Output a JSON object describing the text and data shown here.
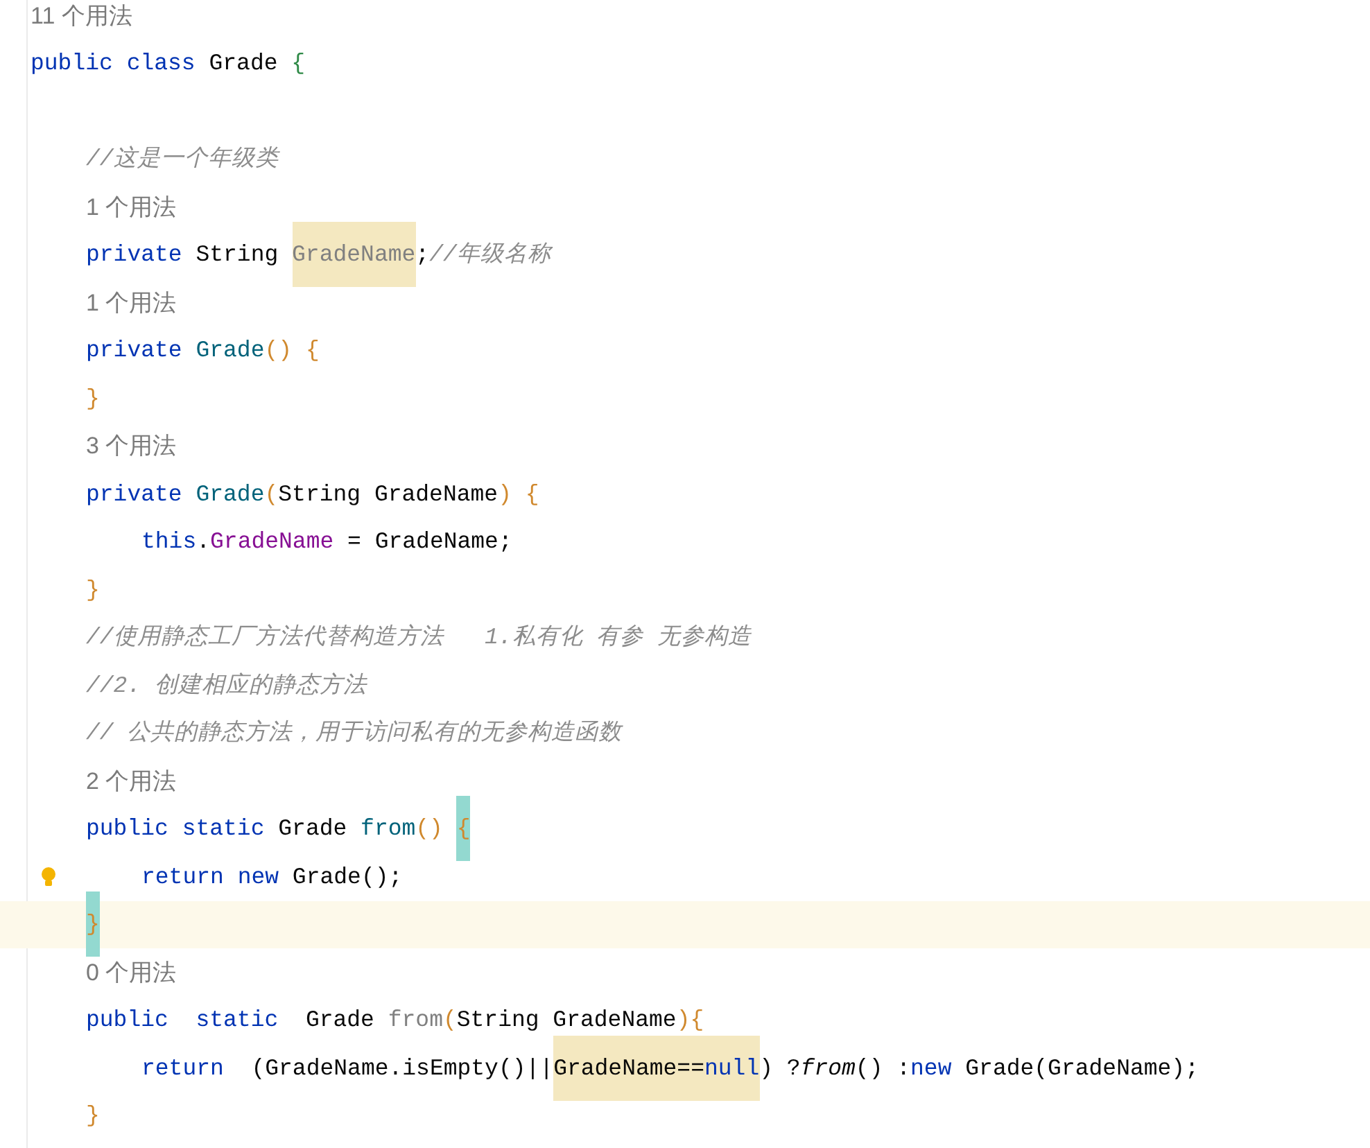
{
  "editor": {
    "lines": [
      {
        "kind": "hint",
        "text": "11 个用法"
      },
      {
        "kind": "code",
        "tokens": [
          {
            "kind": "kw",
            "text": "public"
          },
          {
            "kind": "kw",
            "text": " class"
          },
          {
            "kind": "plain",
            "text": " Grade "
          },
          {
            "kind": "brace2",
            "text": "{"
          }
        ],
        "children": [
          {
            "kind": "blank"
          },
          {
            "kind": "code",
            "tokens": [
              {
                "kind": "comment",
                "text": "//这是一个年级类"
              }
            ]
          },
          {
            "kind": "hint",
            "text": "1 个用法"
          },
          {
            "kind": "code",
            "tokens": [
              {
                "kind": "kw",
                "text": "private"
              },
              {
                "kind": "plain",
                "text": " String "
              },
              {
                "kind": "unused",
                "text": "GradeName",
                "usage_highlight": true
              },
              {
                "kind": "plain",
                "text": ";"
              },
              {
                "kind": "comment",
                "text": "//年级名称"
              }
            ]
          },
          {
            "kind": "hint",
            "text": "1 个用法"
          },
          {
            "kind": "code",
            "tokens": [
              {
                "kind": "kw",
                "text": "private"
              },
              {
                "kind": "decl",
                "text": " Grade"
              },
              {
                "kind": "brace",
                "text": "() {"
              }
            ]
          },
          {
            "kind": "code",
            "tokens": [
              {
                "kind": "brace",
                "text": "}"
              }
            ]
          },
          {
            "kind": "hint",
            "text": "3 个用法"
          },
          {
            "kind": "code",
            "tokens": [
              {
                "kind": "kw",
                "text": "private"
              },
              {
                "kind": "decl",
                "text": " Grade"
              },
              {
                "kind": "brace",
                "text": "("
              },
              {
                "kind": "plain",
                "text": "String GradeName"
              },
              {
                "kind": "brace",
                "text": ") {"
              }
            ],
            "children": [
              {
                "kind": "code",
                "tokens": [
                  {
                    "kind": "kw",
                    "text": "this"
                  },
                  {
                    "kind": "plain",
                    "text": "."
                  },
                  {
                    "kind": "field",
                    "text": "GradeName"
                  },
                  {
                    "kind": "plain",
                    "text": " = GradeName;"
                  }
                ]
              }
            ]
          },
          {
            "kind": "code",
            "tokens": [
              {
                "kind": "brace",
                "text": "}"
              }
            ]
          },
          {
            "kind": "code",
            "tokens": [
              {
                "kind": "comment",
                "text": "//使用静态工厂方法代替构造方法   1.私有化 有参 无参构造"
              }
            ]
          },
          {
            "kind": "code",
            "tokens": [
              {
                "kind": "comment",
                "text": "//2. 创建相应的静态方法"
              }
            ]
          },
          {
            "kind": "code",
            "tokens": [
              {
                "kind": "comment",
                "text": "// 公共的静态方法，用于访问私有的无参构造函数"
              }
            ]
          },
          {
            "kind": "hint",
            "text": "2 个用法"
          },
          {
            "kind": "code",
            "tokens": [
              {
                "kind": "kw",
                "text": "public"
              },
              {
                "kind": "kw",
                "text": " static"
              },
              {
                "kind": "plain",
                "text": " Grade "
              },
              {
                "kind": "decl",
                "text": "from"
              },
              {
                "kind": "brace",
                "text": "() "
              },
              {
                "kind": "brace",
                "text": "{",
                "brace_match": true
              }
            ],
            "children": [
              {
                "kind": "code",
                "bulb": true,
                "tokens": [
                  {
                    "kind": "kw",
                    "text": "return"
                  },
                  {
                    "kind": "kw",
                    "text": " new"
                  },
                  {
                    "kind": "plain",
                    "text": " Grade();"
                  }
                ]
              }
            ]
          },
          {
            "kind": "code",
            "current": true,
            "tokens": [
              {
                "kind": "brace",
                "text": "}",
                "brace_match": true
              }
            ]
          },
          {
            "kind": "hint",
            "text": "0 个用法"
          },
          {
            "kind": "code",
            "tokens": [
              {
                "kind": "kw",
                "text": "public"
              },
              {
                "kind": "kw",
                "text": "  static"
              },
              {
                "kind": "plain",
                "text": "  Grade "
              },
              {
                "kind": "unused",
                "text": "from"
              },
              {
                "kind": "brace",
                "text": "("
              },
              {
                "kind": "plain",
                "text": "String GradeName"
              },
              {
                "kind": "brace",
                "text": "){"
              }
            ],
            "children": [
              {
                "kind": "code",
                "tokens": [
                  {
                    "kind": "kw",
                    "text": "return"
                  },
                  {
                    "kind": "plain",
                    "text": "  (GradeName.isEmpty()||"
                  },
                  {
                    "kind": "plain",
                    "text": "GradeName==",
                    "usage_highlight": true
                  },
                  {
                    "kind": "kw",
                    "text": "null",
                    "usage_highlight": true
                  },
                  {
                    "kind": "plain",
                    "text": ") ?"
                  },
                  {
                    "kind": "static",
                    "text": "from"
                  },
                  {
                    "kind": "plain",
                    "text": "() :"
                  },
                  {
                    "kind": "kw",
                    "text": "new"
                  },
                  {
                    "kind": "plain",
                    "text": " Grade(GradeName);"
                  }
                ]
              }
            ]
          },
          {
            "kind": "code",
            "tokens": [
              {
                "kind": "brace",
                "text": "}"
              }
            ]
          }
        ]
      }
    ]
  }
}
